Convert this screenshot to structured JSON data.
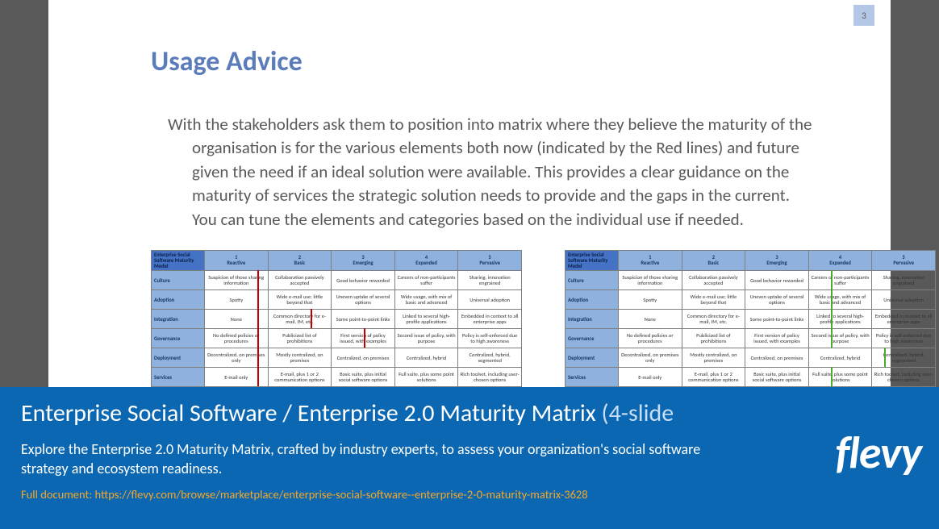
{
  "slide": {
    "page_number": "3",
    "title": "Usage Advice",
    "body": "With the stakeholders ask them to position into matrix where they believe the maturity of the organisation is for the various elements both now (indicated by the Red lines) and future given the need if an ideal solution were available.  This provides a clear guidance on the maturity of services the strategic solution needs to provide and the gaps in the current. You can tune the elements and categories based on the individual use if needed."
  },
  "matrix": {
    "corner": "Enterprise Social Software Maturity Model",
    "columns": [
      {
        "num": "1",
        "label": "Reactive"
      },
      {
        "num": "2",
        "label": "Basic"
      },
      {
        "num": "3",
        "label": "Emerging"
      },
      {
        "num": "4",
        "label": "Expanded"
      },
      {
        "num": "5",
        "label": "Pervasive"
      }
    ],
    "rows": [
      {
        "label": "Culture",
        "cells": [
          "Suspicion of those sharing information",
          "Collaboration passively accepted",
          "Good behavior rewarded",
          "Careers of non-participants suffer",
          "Sharing, innovation engrained"
        ]
      },
      {
        "label": "Adoption",
        "cells": [
          "Spotty",
          "Wide e-mail use; little beyond that",
          "Uneven uptake of several options",
          "Wide usage, with mix of basic and advanced",
          "Universal adoption"
        ]
      },
      {
        "label": "Integration",
        "cells": [
          "None",
          "Common directory for e-mail, IM, etc.",
          "Some point-to-point links",
          "Linked to several high-profile applications",
          "Embedded in context to all enterprise apps"
        ]
      },
      {
        "label": "Governance",
        "cells": [
          "No defined policies or procedures",
          "Publicized list of prohibitions",
          "First version of policy issued, with examples",
          "Second issue of policy, with purpose",
          "Policy is self-enforced due to high awareness"
        ]
      },
      {
        "label": "Deployment",
        "cells": [
          "Decentralized, on premises only",
          "Mostly centralized, on premises",
          "Centralized, on premises",
          "Centralized, hybrid",
          "Centralized, hybrid, segmented"
        ]
      },
      {
        "label": "Services",
        "cells": [
          "E-mail only",
          "E-mail, plus 1 or 2 communication options",
          "Basic suite, plus initial social software options",
          "Full suite, plus some point solutions",
          "Rich toolset, including user-chosen options"
        ]
      }
    ]
  },
  "banner": {
    "title_lead": "Enterprise Social Software / Enterprise 2.0 Maturity Matrix",
    "title_trail": " (4-slide",
    "sub": "Explore the Enterprise 2.0 Maturity Matrix, crafted by industry experts, to assess your organization's social software strategy and ecosystem readiness.",
    "link_label": "Full document:",
    "link": "https://flevy.com/browse/marketplace/enterprise-social-software--enterprise-2-0-maturity-matrix-3628",
    "brand": "flevy"
  }
}
